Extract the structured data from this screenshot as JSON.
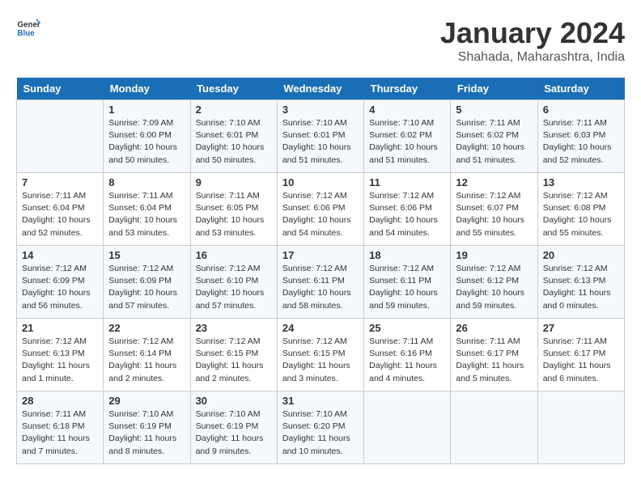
{
  "header": {
    "logo_general": "General",
    "logo_blue": "Blue",
    "title": "January 2024",
    "subtitle": "Shahada, Maharashtra, India"
  },
  "calendar": {
    "days_of_week": [
      "Sunday",
      "Monday",
      "Tuesday",
      "Wednesday",
      "Thursday",
      "Friday",
      "Saturday"
    ],
    "weeks": [
      [
        {
          "day": "",
          "sunrise": "",
          "sunset": "",
          "daylight": ""
        },
        {
          "day": "1",
          "sunrise": "Sunrise: 7:09 AM",
          "sunset": "Sunset: 6:00 PM",
          "daylight": "Daylight: 10 hours and 50 minutes."
        },
        {
          "day": "2",
          "sunrise": "Sunrise: 7:10 AM",
          "sunset": "Sunset: 6:01 PM",
          "daylight": "Daylight: 10 hours and 50 minutes."
        },
        {
          "day": "3",
          "sunrise": "Sunrise: 7:10 AM",
          "sunset": "Sunset: 6:01 PM",
          "daylight": "Daylight: 10 hours and 51 minutes."
        },
        {
          "day": "4",
          "sunrise": "Sunrise: 7:10 AM",
          "sunset": "Sunset: 6:02 PM",
          "daylight": "Daylight: 10 hours and 51 minutes."
        },
        {
          "day": "5",
          "sunrise": "Sunrise: 7:11 AM",
          "sunset": "Sunset: 6:02 PM",
          "daylight": "Daylight: 10 hours and 51 minutes."
        },
        {
          "day": "6",
          "sunrise": "Sunrise: 7:11 AM",
          "sunset": "Sunset: 6:03 PM",
          "daylight": "Daylight: 10 hours and 52 minutes."
        }
      ],
      [
        {
          "day": "7",
          "sunrise": "Sunrise: 7:11 AM",
          "sunset": "Sunset: 6:04 PM",
          "daylight": "Daylight: 10 hours and 52 minutes."
        },
        {
          "day": "8",
          "sunrise": "Sunrise: 7:11 AM",
          "sunset": "Sunset: 6:04 PM",
          "daylight": "Daylight: 10 hours and 53 minutes."
        },
        {
          "day": "9",
          "sunrise": "Sunrise: 7:11 AM",
          "sunset": "Sunset: 6:05 PM",
          "daylight": "Daylight: 10 hours and 53 minutes."
        },
        {
          "day": "10",
          "sunrise": "Sunrise: 7:12 AM",
          "sunset": "Sunset: 6:06 PM",
          "daylight": "Daylight: 10 hours and 54 minutes."
        },
        {
          "day": "11",
          "sunrise": "Sunrise: 7:12 AM",
          "sunset": "Sunset: 6:06 PM",
          "daylight": "Daylight: 10 hours and 54 minutes."
        },
        {
          "day": "12",
          "sunrise": "Sunrise: 7:12 AM",
          "sunset": "Sunset: 6:07 PM",
          "daylight": "Daylight: 10 hours and 55 minutes."
        },
        {
          "day": "13",
          "sunrise": "Sunrise: 7:12 AM",
          "sunset": "Sunset: 6:08 PM",
          "daylight": "Daylight: 10 hours and 55 minutes."
        }
      ],
      [
        {
          "day": "14",
          "sunrise": "Sunrise: 7:12 AM",
          "sunset": "Sunset: 6:09 PM",
          "daylight": "Daylight: 10 hours and 56 minutes."
        },
        {
          "day": "15",
          "sunrise": "Sunrise: 7:12 AM",
          "sunset": "Sunset: 6:09 PM",
          "daylight": "Daylight: 10 hours and 57 minutes."
        },
        {
          "day": "16",
          "sunrise": "Sunrise: 7:12 AM",
          "sunset": "Sunset: 6:10 PM",
          "daylight": "Daylight: 10 hours and 57 minutes."
        },
        {
          "day": "17",
          "sunrise": "Sunrise: 7:12 AM",
          "sunset": "Sunset: 6:11 PM",
          "daylight": "Daylight: 10 hours and 58 minutes."
        },
        {
          "day": "18",
          "sunrise": "Sunrise: 7:12 AM",
          "sunset": "Sunset: 6:11 PM",
          "daylight": "Daylight: 10 hours and 59 minutes."
        },
        {
          "day": "19",
          "sunrise": "Sunrise: 7:12 AM",
          "sunset": "Sunset: 6:12 PM",
          "daylight": "Daylight: 10 hours and 59 minutes."
        },
        {
          "day": "20",
          "sunrise": "Sunrise: 7:12 AM",
          "sunset": "Sunset: 6:13 PM",
          "daylight": "Daylight: 11 hours and 0 minutes."
        }
      ],
      [
        {
          "day": "21",
          "sunrise": "Sunrise: 7:12 AM",
          "sunset": "Sunset: 6:13 PM",
          "daylight": "Daylight: 11 hours and 1 minute."
        },
        {
          "day": "22",
          "sunrise": "Sunrise: 7:12 AM",
          "sunset": "Sunset: 6:14 PM",
          "daylight": "Daylight: 11 hours and 2 minutes."
        },
        {
          "day": "23",
          "sunrise": "Sunrise: 7:12 AM",
          "sunset": "Sunset: 6:15 PM",
          "daylight": "Daylight: 11 hours and 2 minutes."
        },
        {
          "day": "24",
          "sunrise": "Sunrise: 7:12 AM",
          "sunset": "Sunset: 6:15 PM",
          "daylight": "Daylight: 11 hours and 3 minutes."
        },
        {
          "day": "25",
          "sunrise": "Sunrise: 7:11 AM",
          "sunset": "Sunset: 6:16 PM",
          "daylight": "Daylight: 11 hours and 4 minutes."
        },
        {
          "day": "26",
          "sunrise": "Sunrise: 7:11 AM",
          "sunset": "Sunset: 6:17 PM",
          "daylight": "Daylight: 11 hours and 5 minutes."
        },
        {
          "day": "27",
          "sunrise": "Sunrise: 7:11 AM",
          "sunset": "Sunset: 6:17 PM",
          "daylight": "Daylight: 11 hours and 6 minutes."
        }
      ],
      [
        {
          "day": "28",
          "sunrise": "Sunrise: 7:11 AM",
          "sunset": "Sunset: 6:18 PM",
          "daylight": "Daylight: 11 hours and 7 minutes."
        },
        {
          "day": "29",
          "sunrise": "Sunrise: 7:10 AM",
          "sunset": "Sunset: 6:19 PM",
          "daylight": "Daylight: 11 hours and 8 minutes."
        },
        {
          "day": "30",
          "sunrise": "Sunrise: 7:10 AM",
          "sunset": "Sunset: 6:19 PM",
          "daylight": "Daylight: 11 hours and 9 minutes."
        },
        {
          "day": "31",
          "sunrise": "Sunrise: 7:10 AM",
          "sunset": "Sunset: 6:20 PM",
          "daylight": "Daylight: 11 hours and 10 minutes."
        },
        {
          "day": "",
          "sunrise": "",
          "sunset": "",
          "daylight": ""
        },
        {
          "day": "",
          "sunrise": "",
          "sunset": "",
          "daylight": ""
        },
        {
          "day": "",
          "sunrise": "",
          "sunset": "",
          "daylight": ""
        }
      ]
    ]
  }
}
